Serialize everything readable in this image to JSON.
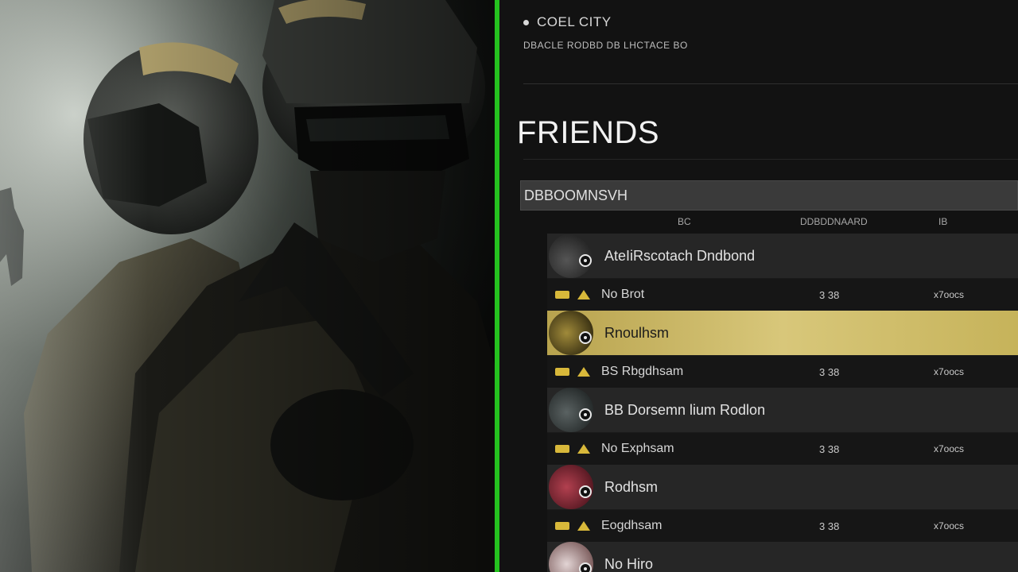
{
  "header": {
    "server_label": "COEL CITY",
    "sub_label": "DBACLE RODBD DB LHCTACE BO"
  },
  "title": "FRIENDS",
  "search": {
    "value": "DBBOOMNSVH"
  },
  "columns": {
    "col1": "BC",
    "col2": "DDBDDNAARD",
    "col3": "IB"
  },
  "friends": [
    {
      "name": "AteIiRscotach Dndbond",
      "avatar_color": "#3a3a3a",
      "selected": false,
      "status": {
        "label": "No Brot",
        "value": "3 38",
        "time": "x7oocs"
      }
    },
    {
      "name": "Rnoulhsm",
      "avatar_color": "#6b5a20",
      "selected": true
    },
    {
      "name": "",
      "avatar_color": "",
      "selected": false,
      "status": {
        "label": "BS Rbgdhsam",
        "value": "3 38",
        "time": "x7oocs"
      }
    },
    {
      "name": "BB Dorsemn lium Rodlon",
      "avatar_color": "#3f4646",
      "selected": false,
      "status": {
        "label": "No Exphsam",
        "value": "3 38",
        "time": "x7oocs"
      }
    },
    {
      "name": "Rodhsm",
      "avatar_color": "#8d2f3c",
      "selected": false,
      "status": {
        "label": "Eogdhsam",
        "value": "3 38",
        "time": "x7oocs"
      }
    },
    {
      "name": "No Hiro",
      "avatar_color": "#c9b8b8",
      "selected": false
    }
  ],
  "colors": {
    "accent_green": "#25c21f",
    "selected_gold": "#c9b458",
    "status_icon": "#d8b83a"
  }
}
